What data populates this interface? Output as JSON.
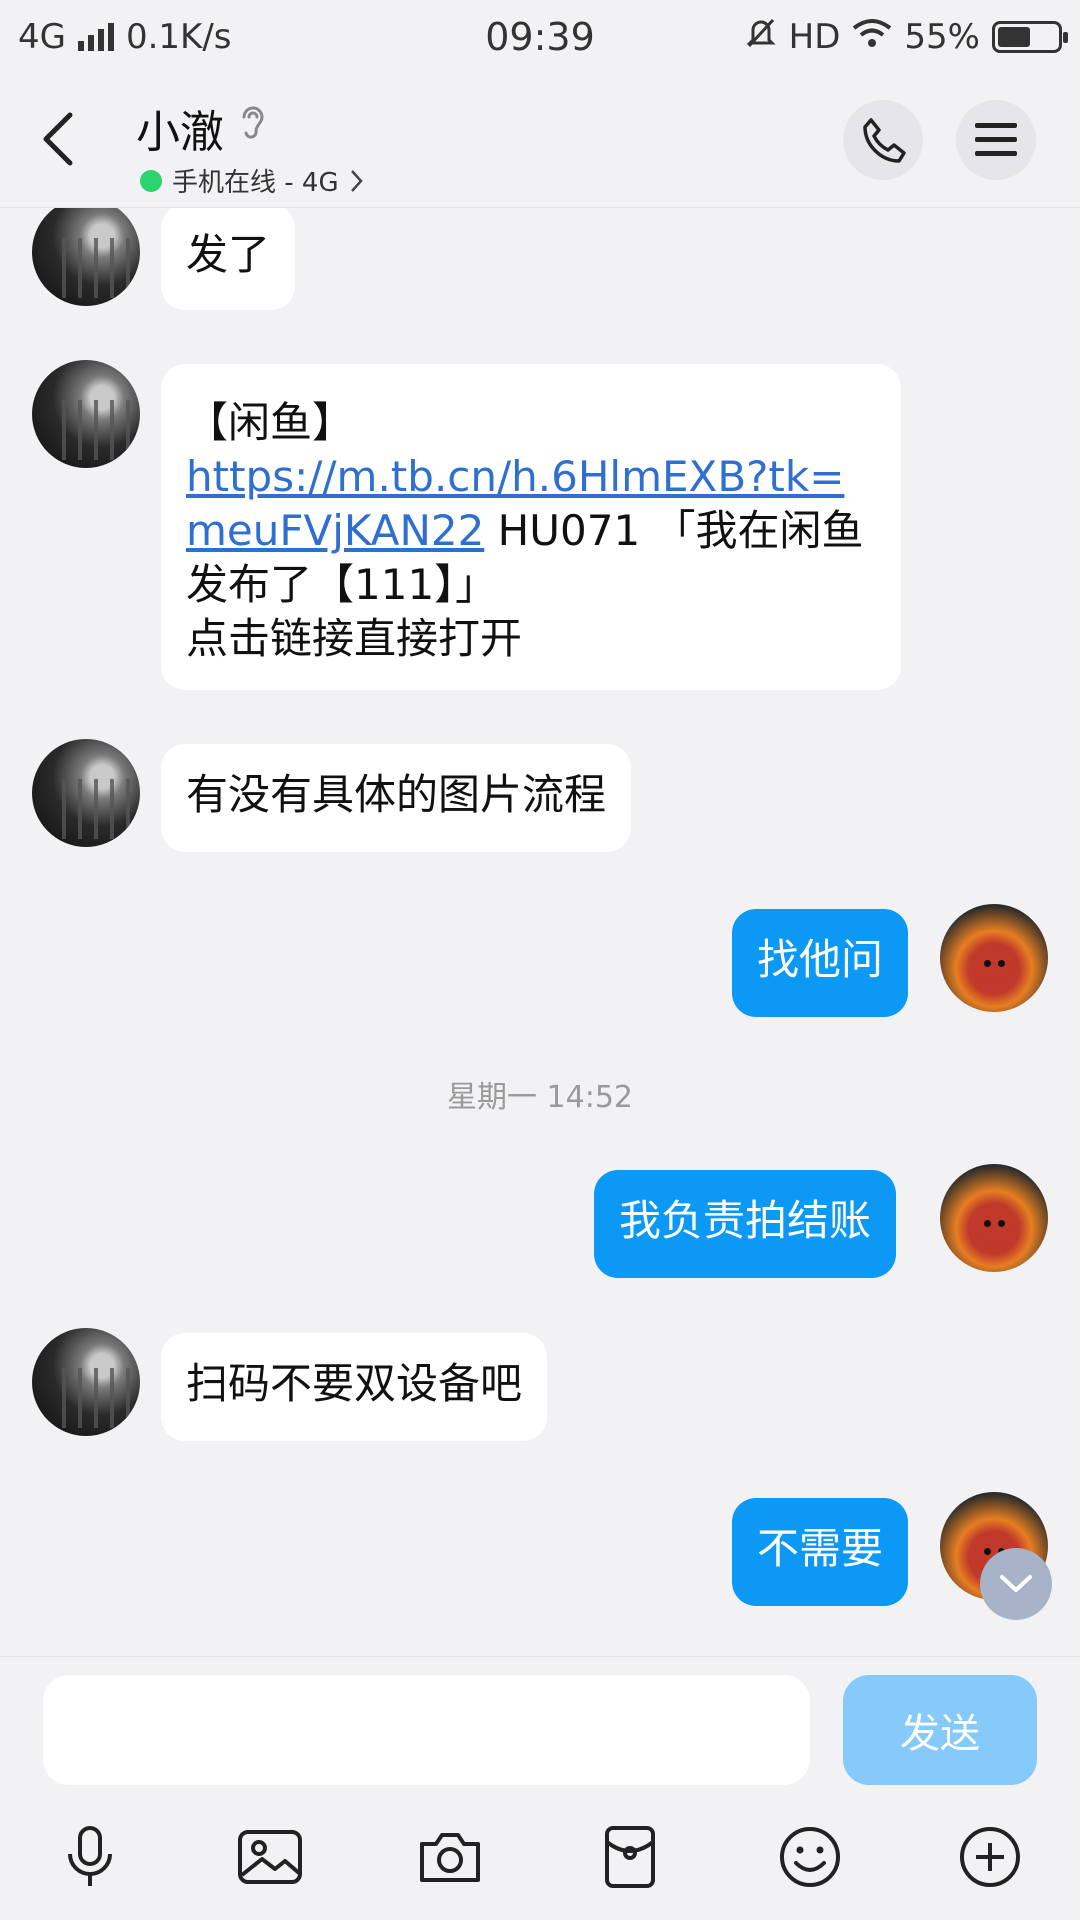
{
  "status_bar": {
    "network": "4G",
    "speed": "0.1K/s",
    "time": "09:39",
    "hd": "HD",
    "battery": "55%",
    "battery_level": 0.55
  },
  "header": {
    "contact_name": "小澈",
    "status": "手机在线 - 4G",
    "status_color": "#2bd46d"
  },
  "messages": [
    {
      "from": "friend",
      "text": "发了"
    },
    {
      "from": "friend",
      "parts": {
        "line1": "【闲鱼】",
        "link": "https://m.tb.cn/h.6HlmEXB?tk=meuFVjKAN22",
        "rest": " HU071 「我在闲鱼发布了【111】」",
        "line3": "点击链接直接打开"
      }
    },
    {
      "from": "friend",
      "text": "有没有具体的图片流程"
    },
    {
      "from": "me",
      "text": "找他问"
    },
    {
      "from": "me",
      "text": "我负责拍结账"
    },
    {
      "from": "friend",
      "text": "扫码不要双设备吧"
    },
    {
      "from": "me",
      "text": "不需要"
    }
  ],
  "time_divider": "星期一 14:52",
  "input": {
    "value": "",
    "placeholder": "",
    "send_label": "发送"
  },
  "toolbar": [
    "voice-icon",
    "image-icon",
    "camera-icon",
    "red-packet-icon",
    "emoji-icon",
    "plus-icon"
  ],
  "colors": {
    "outgoing_bubble": "#0c99f5",
    "send_button": "#86c9fb",
    "link": "#2f6fcf",
    "background": "#f2f2f4"
  }
}
